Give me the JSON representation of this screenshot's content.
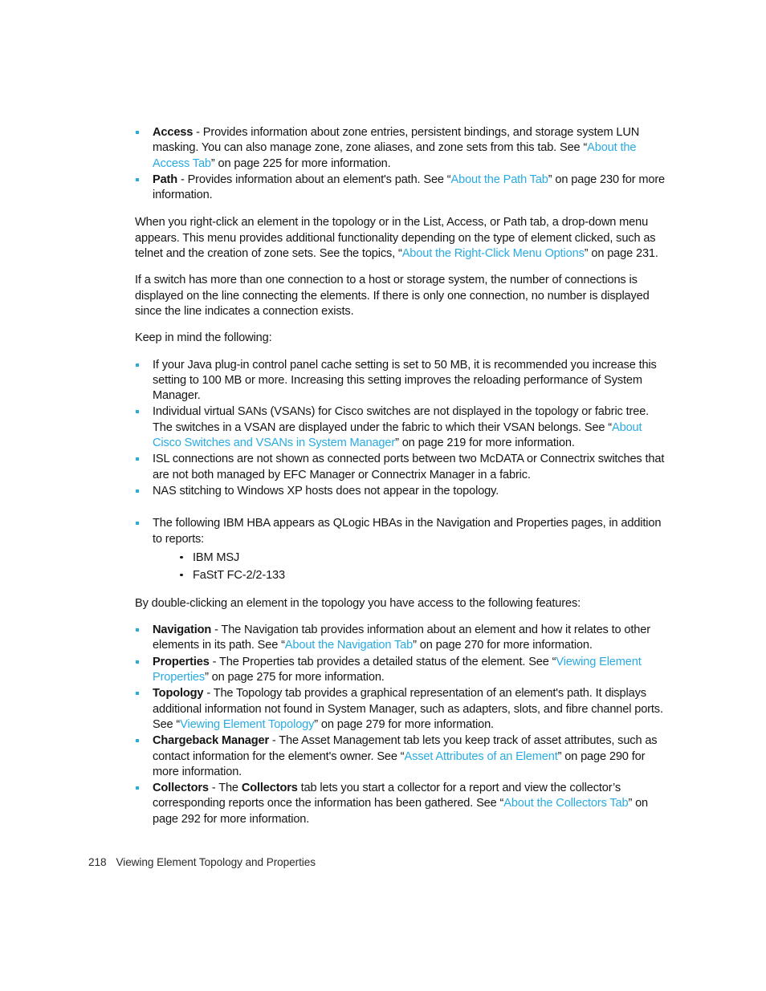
{
  "page": {
    "number": "218",
    "footer_title": "Viewing Element Topology and Properties",
    "link_color": "#29abe2",
    "bullet_color": "#29abe2",
    "text_color": "#151515",
    "background": "#ffffff"
  },
  "tab_list": [
    {
      "term": "Access",
      "dash": " - ",
      "text_1": "Provides information about zone entries, persistent bindings, and storage system LUN masking. You can also manage zone, zone aliases, and zone sets from this tab. See “",
      "link": "About the Access Tab",
      "text_2": "” on page 225 for more information."
    },
    {
      "term": "Path",
      "dash": " - ",
      "text_1": "Provides information about an element's path. See “",
      "link": "About the Path Tab",
      "text_2": "” on page 230 for more information."
    }
  ],
  "para_rightclick": {
    "text_1": "When you right-click an element in the topology or in the List, Access, or Path tab, a drop-down menu appears. This menu provides additional functionality depending on the type of element clicked, such as telnet and the creation of zone sets. See the topics, “",
    "link": "About the Right-Click Menu Options",
    "text_2": "” on page 231."
  },
  "para_switch": {
    "text": "If a switch has more than one connection to a host or storage system, the number of connections is displayed on the line connecting the elements. If there is only one connection, no number is displayed since the line indicates a connection exists."
  },
  "para_keep_in_mind": {
    "text": "Keep in mind the following:"
  },
  "keep_in_mind_list": [
    {
      "text": "If your Java plug-in control panel cache setting is set to 50 MB, it is recommended you increase this setting to 100 MB or more. Increasing this setting improves the reloading performance of System Manager."
    },
    {
      "text_1": "Individual virtual SANs (VSANs) for Cisco switches are not displayed in the topology or fabric tree. The switches in a VSAN are displayed under the fabric to which their VSAN belongs. See “",
      "link": "About Cisco Switches and VSANs in System Manager",
      "text_2": "” on page 219 for more information."
    },
    {
      "text": "ISL connections are not shown as connected ports between two McDATA or Connectrix switches that are not both managed by EFC Manager or Connectrix Manager in a fabric."
    },
    {
      "text": "NAS stitching to Windows XP hosts does not appear in the topology."
    }
  ],
  "hba_item": {
    "text": "The following IBM HBA appears as QLogic HBAs in the Navigation and Properties pages, in addition to reports:",
    "sub_items": [
      {
        "text": "IBM MSJ"
      },
      {
        "text": "FaStT FC-2/2-133"
      }
    ]
  },
  "para_doubleclick": {
    "text": "By double-clicking an element in the topology you have access to the following features:"
  },
  "feature_list": [
    {
      "term": "Navigation",
      "dash": " - ",
      "text_1": "The Navigation tab provides information about an element and how it relates to other elements in its path. See “",
      "link": "About the Navigation Tab",
      "text_2": "” on page 270 for more information."
    },
    {
      "term": "Properties",
      "dash": " - ",
      "text_1": "The Properties tab provides a detailed status of the element. See “",
      "link": "Viewing Element Properties",
      "text_2": "” on page 275 for more information."
    },
    {
      "term": "Topology",
      "dash": " - ",
      "text_1": "The Topology tab provides a graphical representation of an element's path. It displays additional information not found in System Manager, such as adapters, slots, and fibre channel ports. See “",
      "link": "Viewing Element Topology",
      "text_2": "” on page 279 for more information."
    },
    {
      "term": "Chargeback Manager",
      "dash": " - ",
      "text_1": "The Asset Management tab lets you keep track of asset attributes, such as contact information for the element's owner. See “",
      "link": "Asset Attributes of an Element",
      "text_2": "” on page 290 for more information."
    },
    {
      "term": "Collectors",
      "dash": " - ",
      "text_1": "The ",
      "term_inline": "Collectors",
      "text_1b": " tab lets you start a collector for a report and view the collector’s corresponding reports once the information has been gathered. See “",
      "link": "About the Collectors Tab",
      "text_2": "” on page 292 for more information."
    }
  ]
}
